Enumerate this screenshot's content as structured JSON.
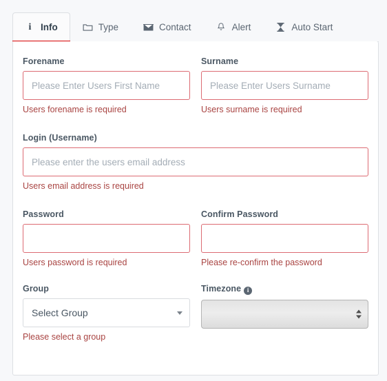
{
  "tabs": [
    {
      "id": "info",
      "label": "Info",
      "icon": "info-icon",
      "active": true
    },
    {
      "id": "type",
      "label": "Type",
      "icon": "folder-icon",
      "active": false
    },
    {
      "id": "contact",
      "label": "Contact",
      "icon": "envelope-icon",
      "active": false
    },
    {
      "id": "alert",
      "label": "Alert",
      "icon": "bell-icon",
      "active": false
    },
    {
      "id": "auto-start",
      "label": "Auto Start",
      "icon": "hourglass-icon",
      "active": false
    }
  ],
  "form": {
    "forename": {
      "label": "Forename",
      "value": "",
      "placeholder": "Please Enter Users First Name",
      "error": "Users forename is required"
    },
    "surname": {
      "label": "Surname",
      "value": "",
      "placeholder": "Please Enter Users Surname",
      "error": "Users surname is required"
    },
    "login": {
      "label": "Login (Username)",
      "value": "",
      "placeholder": "Please enter the users email address",
      "error": "Users email address is required"
    },
    "password": {
      "label": "Password",
      "value": "",
      "placeholder": "",
      "error": "Users password is required"
    },
    "confirm_password": {
      "label": "Confirm Password",
      "value": "",
      "placeholder": "",
      "error": "Please re-confirm the password"
    },
    "group": {
      "label": "Group",
      "selected": "Select Group",
      "error": "Please select a group",
      "caret_icon": "chevron-down-icon"
    },
    "timezone": {
      "label": "Timezone",
      "info_icon": "info-circle-icon",
      "info_glyph": "i",
      "selected": "",
      "spinner_icon": "updown-arrows-icon"
    }
  },
  "colors": {
    "error_text": "#a94442",
    "error_border": "#dc6a72",
    "active_tab_underline": "#d70000",
    "panel_border": "#dcdfe3",
    "label_text": "#4a5763",
    "placeholder_text": "#a4adb6",
    "page_bg": "#f7f8fa"
  }
}
